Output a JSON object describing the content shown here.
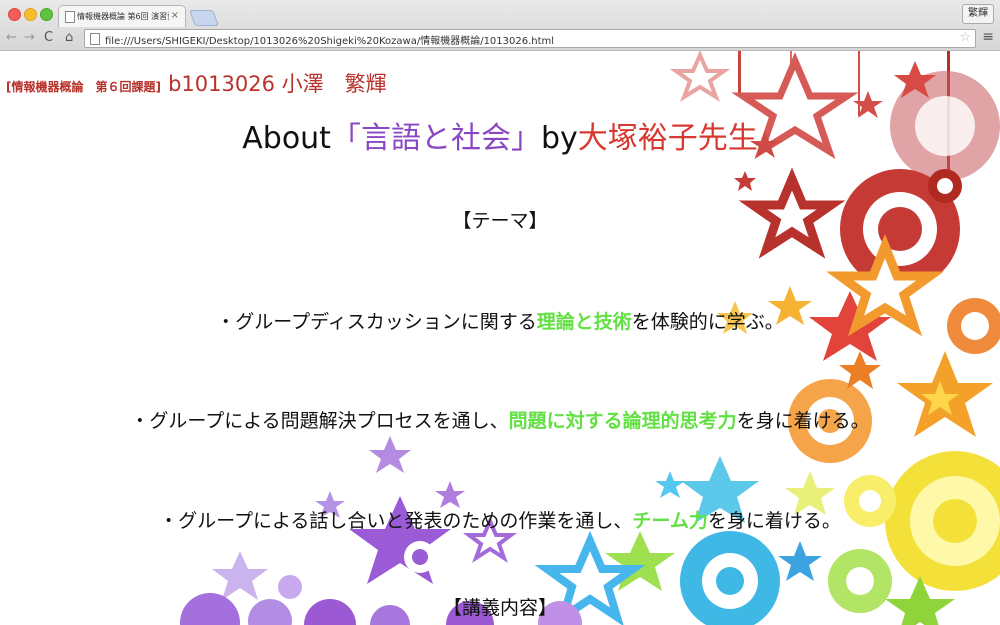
{
  "browser": {
    "tab_title": "情報機器概論 第6回 演習資料",
    "tab_close": "×",
    "profile_label": "繁輝",
    "url": "file:///Users/SHIGEKI/Desktop/1013026%20Shigeki%20Kozawa/情報機器概論/1013026.html",
    "nav": {
      "back": "←",
      "forward": "→",
      "reload": "C",
      "home": "⌂",
      "star": "☆",
      "menu": "≡"
    }
  },
  "page": {
    "course_label": "[情報機器概論　第６回課題]",
    "student": "b1013026 小澤　繁輝",
    "heading": {
      "about": "About",
      "topic": "「言語と社会」",
      "by": "by",
      "lecturer": "大塚裕子先生"
    },
    "theme_header": "【テーマ】",
    "items": [
      {
        "pre": "・グループディスカッションに関する",
        "em": "理論と技術",
        "post": "を体験的に学ぶ。"
      },
      {
        "pre": "・グループによる問題解決プロセスを通し、",
        "em": "問題に対する論理的思考力",
        "post": "を身に着ける。"
      },
      {
        "pre": "・グループによる話し合いと発表のための作業を通し、",
        "em": "チーム力",
        "post": "を身に着ける。"
      }
    ],
    "lecture_header": "【講義内容】"
  },
  "colors": {
    "course": "#b8322b",
    "topic": "#8a47c4",
    "lecturer": "#d8382f",
    "emphasis": "#63e043"
  },
  "icons": {
    "tab": "page-icon",
    "back": "back-arrow-icon",
    "forward": "forward-arrow-icon",
    "reload": "reload-icon",
    "home": "home-icon",
    "bookmark": "star-icon",
    "menu": "hamburger-menu-icon"
  }
}
